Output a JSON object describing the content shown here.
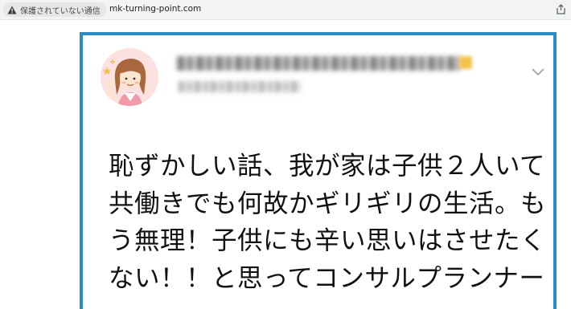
{
  "browser": {
    "security_label": "保護されていない通信",
    "url": "mk-turning-point.com",
    "icons": {
      "security": "warning-triangle-icon",
      "share": "share-icon"
    }
  },
  "tweet": {
    "author_name": "",
    "author_handle": "",
    "avatar": "woman-cheering-avatar",
    "menu_icon": "chevron-down-icon",
    "text_lines": [
      "恥ずかしい話、我が家は子供２人いて",
      "共働きでも何故かギリギリの生活。も",
      "う無理！子供にも辛い思いはさせたく",
      "ない！！と思ってコンサルプランナー"
    ]
  },
  "colors": {
    "card_border": "#2a8bc5",
    "text": "#111111",
    "avatar_bg": "#fbe1df"
  }
}
